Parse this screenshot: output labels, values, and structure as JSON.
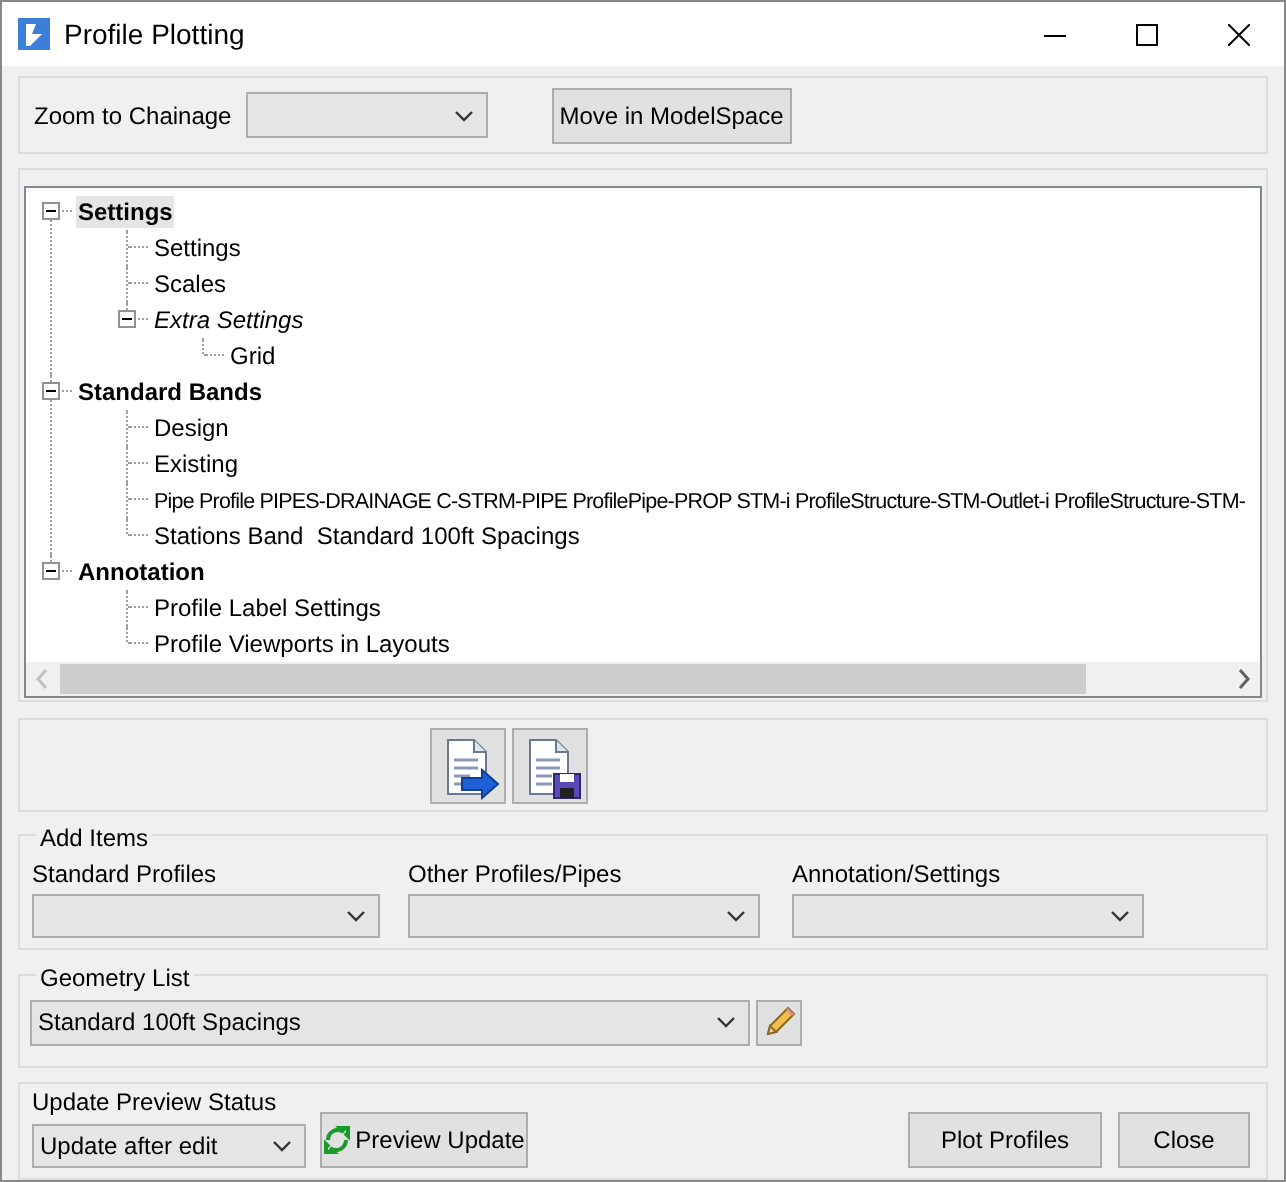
{
  "window": {
    "title": "Profile Plotting"
  },
  "zoom": {
    "label": "Zoom to Chainage"
  },
  "move_button": "Move in ModelSpace",
  "tree": [
    {
      "label": "Settings",
      "kind": "bold",
      "selected": true,
      "expanded": true,
      "children": [
        {
          "label": "Settings",
          "kind": "normal",
          "selected": false
        },
        {
          "label": "Scales",
          "kind": "normal",
          "selected": false
        },
        {
          "label": "Extra Settings",
          "kind": "italic",
          "selected": false,
          "expanded": true,
          "children": [
            {
              "label": "Grid",
              "kind": "normal",
              "selected": false
            }
          ]
        }
      ]
    },
    {
      "label": "Standard Bands",
      "kind": "bold",
      "selected": false,
      "expanded": true,
      "children": [
        {
          "label": "Design",
          "kind": "normal",
          "selected": false
        },
        {
          "label": "Existing",
          "kind": "normal",
          "selected": false
        },
        {
          "label": "Pipe Profile PIPES-DRAINAGE C-STRM-PIPE ProfilePipe-PROP STM-i ProfileStructure-STM-Outlet-i ProfileStructure-STM-",
          "kind": "normal",
          "selected": false
        },
        {
          "label": "Stations Band  Standard 100ft Spacings",
          "kind": "normal",
          "selected": false
        }
      ]
    },
    {
      "label": "Annotation",
      "kind": "bold",
      "selected": false,
      "expanded": true,
      "children": [
        {
          "label": "Profile Label Settings",
          "kind": "normal",
          "selected": false
        },
        {
          "label": "Profile Viewports in Layouts",
          "kind": "normal",
          "selected": false
        }
      ]
    }
  ],
  "add_items": {
    "title": "Add Items",
    "dropdowns": [
      {
        "label": "Standard Profiles"
      },
      {
        "label": "Other Profiles/Pipes"
      },
      {
        "label": "Annotation/Settings"
      }
    ]
  },
  "geometry": {
    "title": "Geometry List",
    "value": "Standard 100ft Spacings"
  },
  "preview": {
    "label": "Update Preview Status",
    "value": "Update after edit",
    "button": "Preview Update"
  },
  "buttons": [
    "Plot Profiles",
    "Close"
  ]
}
